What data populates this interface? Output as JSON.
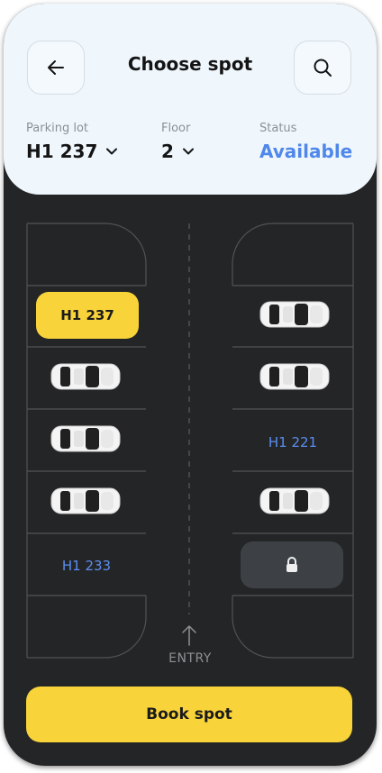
{
  "header": {
    "title": "Choose spot",
    "back_icon": "arrow-left-icon",
    "search_icon": "search-icon"
  },
  "filters": {
    "parking_lot": {
      "label": "Parking lot",
      "value": "H1 237"
    },
    "floor": {
      "label": "Floor",
      "value": "2"
    },
    "status": {
      "label": "Status",
      "value": "Available"
    }
  },
  "lot": {
    "left_spots": [
      {
        "state": "empty"
      },
      {
        "state": "selected",
        "label": "H1 237"
      },
      {
        "state": "occupied"
      },
      {
        "state": "occupied"
      },
      {
        "state": "occupied"
      },
      {
        "state": "available",
        "label": "H1 233"
      },
      {
        "state": "empty"
      }
    ],
    "right_spots": [
      {
        "state": "empty"
      },
      {
        "state": "occupied"
      },
      {
        "state": "occupied"
      },
      {
        "state": "available",
        "label": "H1 221"
      },
      {
        "state": "occupied"
      },
      {
        "state": "locked",
        "icon": "lock-icon"
      },
      {
        "state": "empty"
      }
    ],
    "entry_label": "ENTRY"
  },
  "actions": {
    "book_label": "Book spot"
  },
  "colors": {
    "accent_yellow": "#f8d33a",
    "accent_blue": "#4f87ea",
    "background_dark": "#242526",
    "header_bg": "#eff7fd"
  }
}
